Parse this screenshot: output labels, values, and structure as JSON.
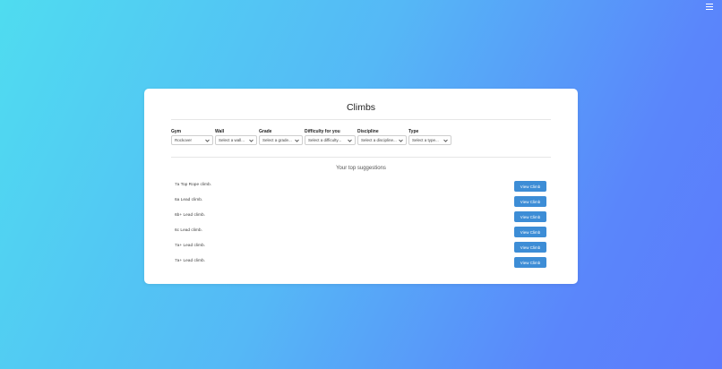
{
  "page": {
    "title": "Climbs",
    "suggestions_title": "Your top suggestions"
  },
  "filters": [
    {
      "label": "Gym",
      "value": "Rockover"
    },
    {
      "label": "Wall",
      "value": "Select a wall..."
    },
    {
      "label": "Grade",
      "value": "Select a grade..."
    },
    {
      "label": "Difficulty for you",
      "value": "Select a difficulty..."
    },
    {
      "label": "Discipline",
      "value": "Select a discipline..."
    },
    {
      "label": "Type",
      "value": "Select a type..."
    }
  ],
  "climbs": [
    {
      "name": "7a Top Rope climb.",
      "button": "View Climb"
    },
    {
      "name": "6a Lead climb.",
      "button": "View Climb"
    },
    {
      "name": "6b+ Lead climb.",
      "button": "View Climb"
    },
    {
      "name": "6c Lead climb.",
      "button": "View Climb"
    },
    {
      "name": "7a+ Lead climb.",
      "button": "View Climb"
    },
    {
      "name": "7a+ Lead climb.",
      "button": "View Climb"
    }
  ],
  "icons": {
    "menu": "hamburger-menu-icon",
    "dropdown": "chevron-down-icon"
  },
  "colors": {
    "accent": "#3d8dd6",
    "gradient_start": "#4fdcf0",
    "gradient_end": "#5c7afc"
  }
}
